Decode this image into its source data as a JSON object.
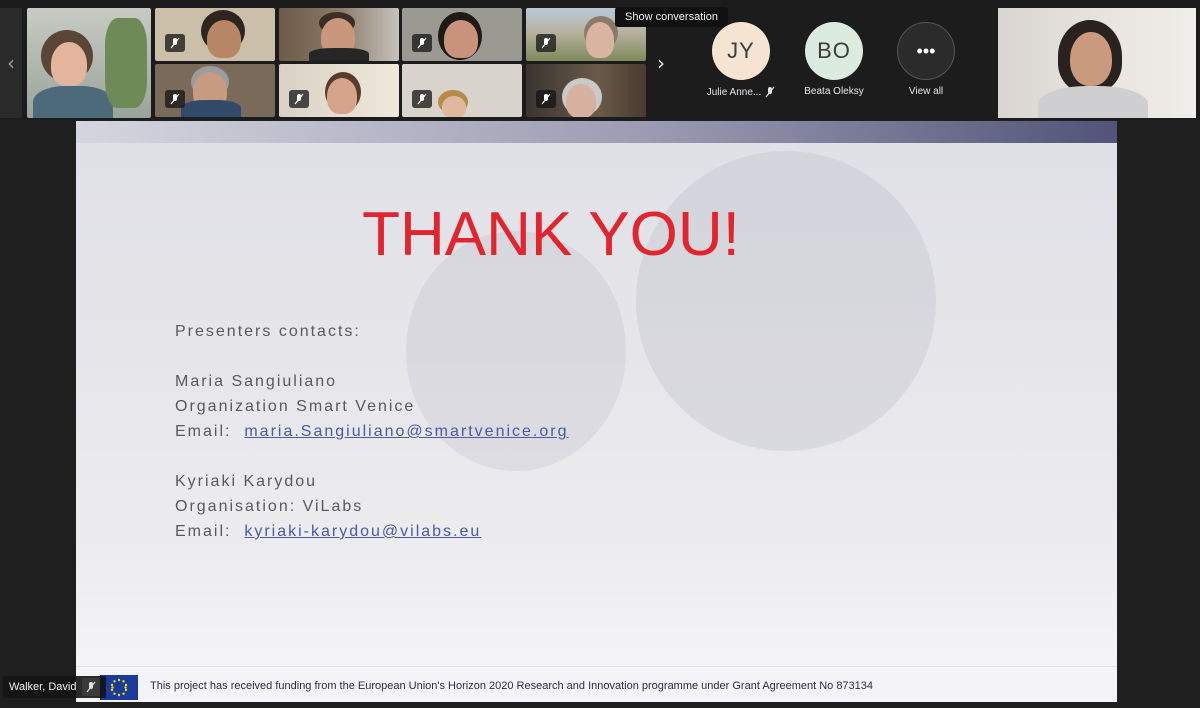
{
  "gallery": {
    "prev_icon": "chevron-left-icon",
    "next_icon": "chevron-right-icon",
    "tooltip": "Show conversation",
    "avatars": [
      {
        "initials": "JY",
        "name": "Julie Anne...",
        "color": "#f6e4d2",
        "muted": true
      },
      {
        "initials": "BO",
        "name": "Beata Oleksy",
        "color": "#dcebdf",
        "muted": false
      }
    ],
    "view_all": {
      "label": "View all",
      "icon": "more-icon"
    }
  },
  "slide": {
    "title": "THANK YOU!",
    "contacts_heading": "Presenters contacts:",
    "person1": {
      "name": "Maria Sangiuliano",
      "org": "Organization Smart Venice",
      "email_label": "Email:",
      "email": "maria.Sangiuliano@smartvenice.org"
    },
    "person2": {
      "name": "Kyriaki Karydou",
      "org": "Organisation: ViLabs",
      "email_label": "Email:",
      "email": "kyriaki-karydou@vilabs.eu"
    },
    "footer": "This project has received funding from the European Union's Horizon 2020 Research and Innovation programme under Grant Agreement No 873134"
  },
  "presenter_tag": {
    "name": "Walker, David",
    "icon": "mic-muted-icon"
  }
}
